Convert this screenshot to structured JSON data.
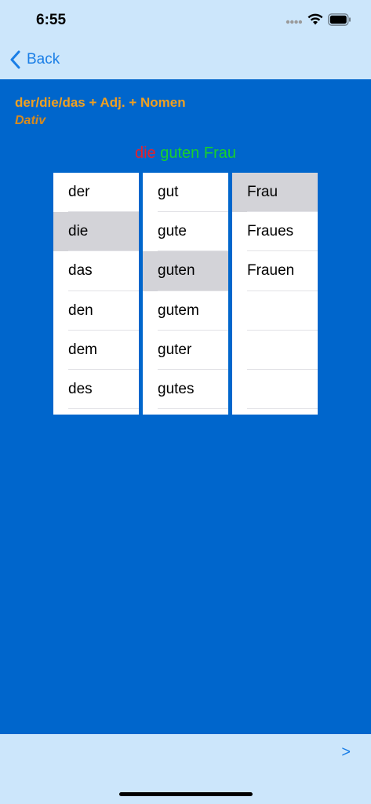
{
  "status": {
    "time": "6:55"
  },
  "nav": {
    "back_label": "Back",
    "next_label": ">"
  },
  "header": {
    "title": "der/die/das + Adj. + Nomen",
    "case": "Dativ"
  },
  "phrase": {
    "article": "die",
    "adjective": "guten",
    "noun": "Frau"
  },
  "colors": {
    "accent": "#1a7ee6",
    "background": "#0066cc",
    "bar": "#cce6fb",
    "title": "#f0a020",
    "article_text": "#e8202a",
    "adj_noun_text": "#18d02c",
    "selected_cell": "#d3d3d8"
  },
  "pickers": {
    "articles": [
      "der",
      "die",
      "das",
      "den",
      "dem",
      "des"
    ],
    "adjectives": [
      "gut",
      "gute",
      "guten",
      "gutem",
      "guter",
      "gutes"
    ],
    "nouns": [
      "Frau",
      "Fraues",
      "Frauen",
      "",
      "",
      ""
    ]
  },
  "selected": {
    "articles": 1,
    "adjectives": 2,
    "nouns": 0
  }
}
